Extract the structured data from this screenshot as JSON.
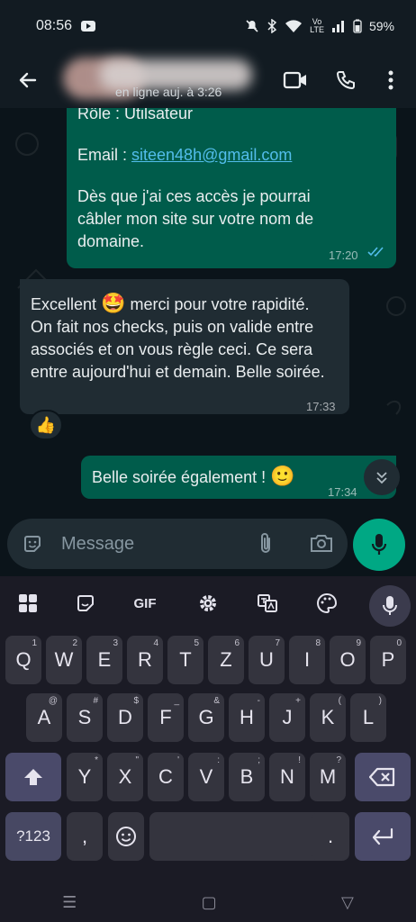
{
  "status_bar": {
    "time": "08:56",
    "battery": "59%",
    "network": "Vo\nLTE"
  },
  "header": {
    "status": "en ligne auj. à 3:26"
  },
  "messages": [
    {
      "direction": "out",
      "lines": [
        "Rôle : Utilsateur"
      ],
      "email_label": "Email : ",
      "email": "siteen48h@gmail.com",
      "body": "Dès que j'ai ces accès je pourrai câbler mon site sur votre nom de domaine.",
      "time": "17:20"
    },
    {
      "direction": "in",
      "body_start": "Excellent ",
      "emoji": "🤩",
      "body_end": " merci pour votre rapidité. On fait nos checks, puis on valide entre associés et on vous règle ceci. Ce sera entre aujourd'hui et demain. Belle soirée.",
      "time": "17:33",
      "reaction": "👍"
    },
    {
      "direction": "out",
      "body": "Belle soirée également ! ",
      "emoji": "🙂",
      "time": "17:34"
    }
  ],
  "composer": {
    "placeholder": "Message"
  },
  "keyboard": {
    "toolbar": {
      "gif": "GIF"
    },
    "row1": [
      {
        "k": "Q",
        "h": "1"
      },
      {
        "k": "W",
        "h": "2"
      },
      {
        "k": "E",
        "h": "3"
      },
      {
        "k": "R",
        "h": "4"
      },
      {
        "k": "T",
        "h": "5"
      },
      {
        "k": "Z",
        "h": "6"
      },
      {
        "k": "U",
        "h": "7"
      },
      {
        "k": "I",
        "h": "8"
      },
      {
        "k": "O",
        "h": "9"
      },
      {
        "k": "P",
        "h": "0"
      }
    ],
    "row2": [
      {
        "k": "A",
        "h": "@"
      },
      {
        "k": "S",
        "h": "#"
      },
      {
        "k": "D",
        "h": "$"
      },
      {
        "k": "F",
        "h": "_"
      },
      {
        "k": "G",
        "h": "&"
      },
      {
        "k": "H",
        "h": "-"
      },
      {
        "k": "J",
        "h": "+"
      },
      {
        "k": "K",
        "h": "("
      },
      {
        "k": "L",
        "h": ")"
      }
    ],
    "row3": [
      {
        "k": "Y",
        "h": "*"
      },
      {
        "k": "X",
        "h": "\""
      },
      {
        "k": "C",
        "h": "'"
      },
      {
        "k": "V",
        "h": ":"
      },
      {
        "k": "B",
        "h": ";"
      },
      {
        "k": "N",
        "h": "!"
      },
      {
        "k": "M",
        "h": "?"
      }
    ],
    "symbols_label": "?123",
    "comma": ",",
    "period": "."
  },
  "nav": {
    "recents": "☰",
    "home": "▢",
    "back": "▽"
  },
  "colors": {
    "accent": "#00a884",
    "outgoing": "#005c4b",
    "incoming": "#202c33",
    "link": "#53bdeb"
  }
}
